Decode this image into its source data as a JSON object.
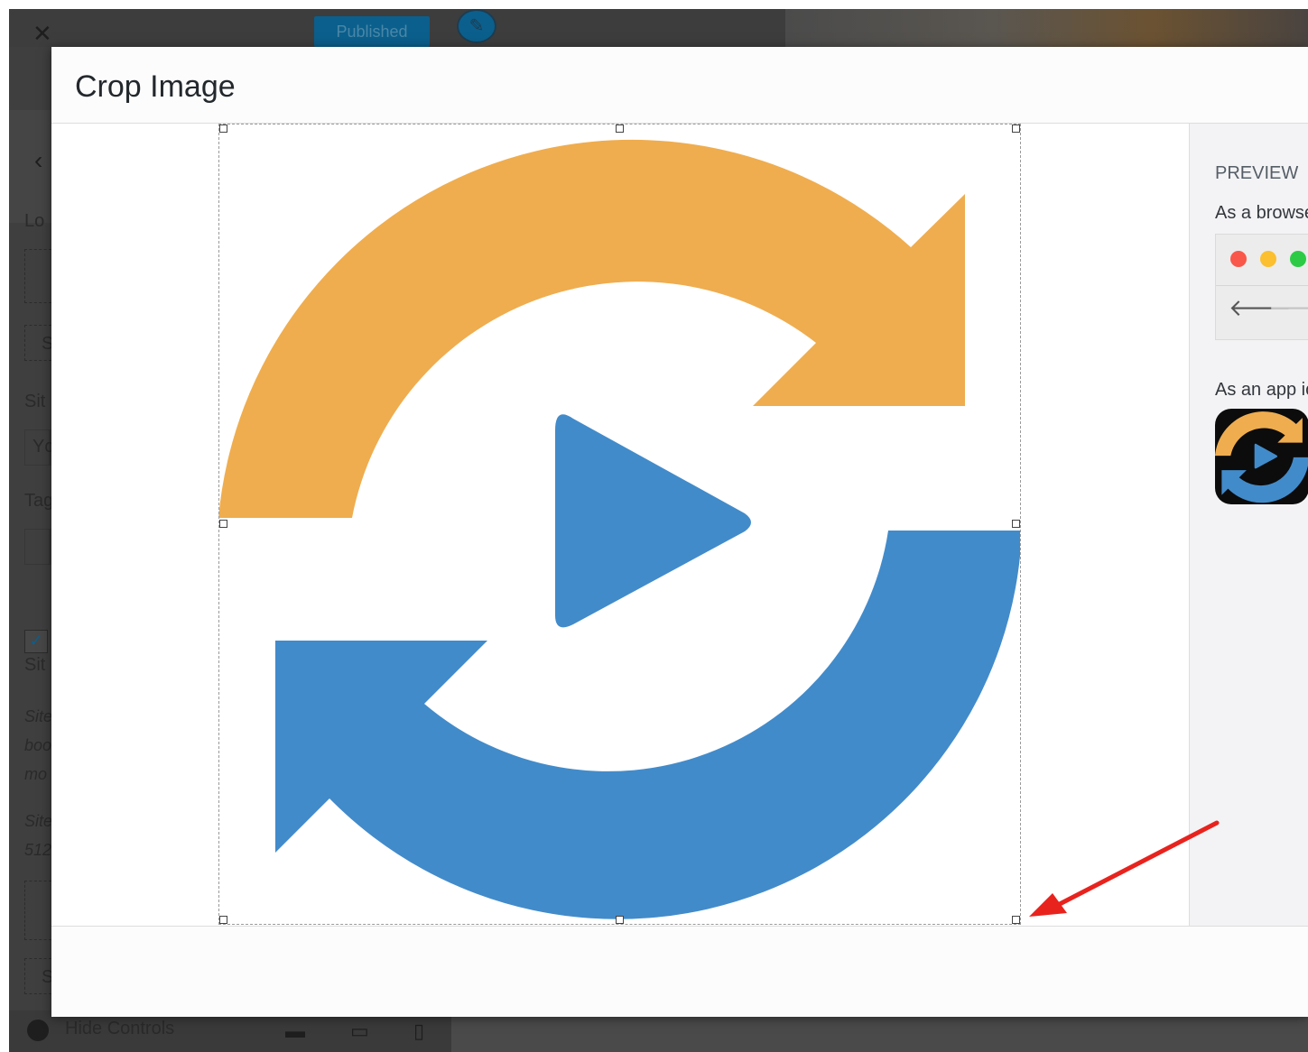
{
  "background": {
    "published_label": "Published",
    "sidebar_fragments": [
      "Lo",
      "S",
      "Sit",
      "Yc",
      "Tag",
      "Sit",
      "Site",
      "boo",
      "mo",
      "Site",
      "512",
      "S"
    ],
    "hide_controls_label": "Hide Controls"
  },
  "modal": {
    "title": "Crop Image",
    "preview": {
      "heading": "PREVIEW",
      "browser_label": "As a browse",
      "app_icon_label": "As an app ic"
    }
  },
  "image": {
    "orange_color": "#efad4f",
    "blue_color": "#428bca"
  },
  "colors": {
    "annotation_arrow": "#e8231e",
    "mac_red": "#f9574a",
    "mac_yellow": "#fbbf2f",
    "mac_green": "#2dcb45"
  },
  "icons": [
    "close-icon",
    "pencil-icon",
    "back-chevron-icon",
    "checkbox-icon",
    "hide-controls-icon",
    "desktop-icon",
    "tablet-icon",
    "mobile-icon",
    "back-arrow-icon",
    "forward-arrow-icon",
    "sync-play-logo"
  ]
}
